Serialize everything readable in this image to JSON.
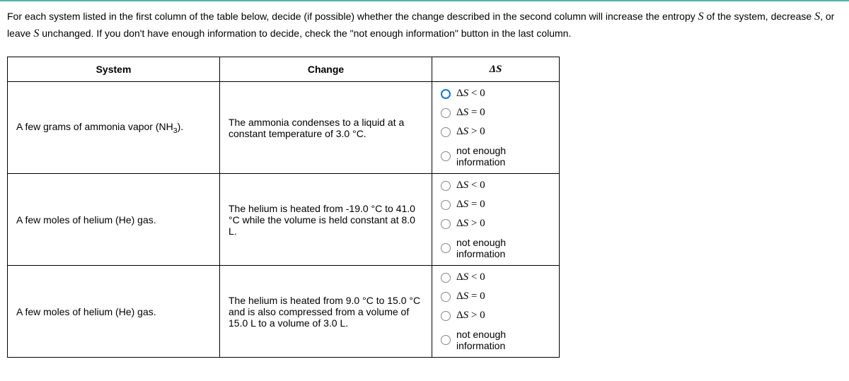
{
  "instructions": {
    "part1": "For each system listed in the first column of the table below, decide (if possible) whether the change described in the second column will increase the entropy ",
    "var1": "S",
    "part2": " of the system, decrease ",
    "var2": "S",
    "part3": ", or leave ",
    "var3": "S",
    "part4": " unchanged. If you don't have enough information to decide, check the \"not enough information\" button in the last column."
  },
  "headers": {
    "system": "System",
    "change": "Change",
    "ds": "ΔS"
  },
  "options": {
    "lt": "ΔS < 0",
    "eq": "ΔS = 0",
    "gt": "ΔS > 0",
    "ne": "not enough information"
  },
  "rows": [
    {
      "system_prefix": "A few grams of ammonia vapor (NH",
      "system_sub": "3",
      "system_suffix": ").",
      "change": "The ammonia condenses to a liquid at a constant temperature of 3.0 °C.",
      "selected": "lt"
    },
    {
      "system_prefix": "A few moles of helium (He) gas.",
      "system_sub": "",
      "system_suffix": "",
      "change": "The helium is heated from -19.0 °C to 41.0 °C while the volume is held constant at 8.0 L.",
      "selected": ""
    },
    {
      "system_prefix": "A few moles of helium (He) gas.",
      "system_sub": "",
      "system_suffix": "",
      "change": "The helium is heated from 9.0 °C to 15.0 °C and is also compressed from a volume of 15.0 L to a volume of 3.0 L.",
      "selected": ""
    }
  ]
}
